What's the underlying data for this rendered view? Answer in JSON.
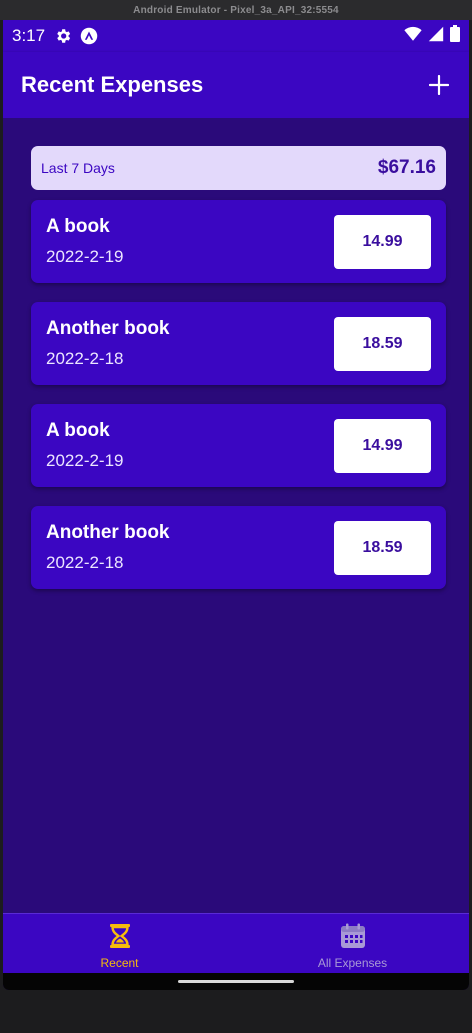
{
  "emulator": {
    "title": "Android Emulator - Pixel_3a_API_32:5554"
  },
  "status_bar": {
    "time": "3:17",
    "icons": [
      "gear-icon",
      "app-logo-icon",
      "wifi-icon",
      "signal-icon",
      "battery-icon"
    ]
  },
  "app_bar": {
    "title": "Recent Expenses",
    "add_icon": "plus-icon"
  },
  "summary": {
    "period": "Last 7 Days",
    "sum": "$67.16"
  },
  "expenses": [
    {
      "description": "A book",
      "date": "2022-2-19",
      "amount": "14.99"
    },
    {
      "description": "Another book",
      "date": "2022-2-18",
      "amount": "18.59"
    },
    {
      "description": "A book",
      "date": "2022-2-19",
      "amount": "14.99"
    },
    {
      "description": "Another book",
      "date": "2022-2-18",
      "amount": "18.59"
    }
  ],
  "tabs": [
    {
      "label": "Recent",
      "icon": "hourglass-icon",
      "active": true
    },
    {
      "label": "All Expenses",
      "icon": "calendar-icon",
      "active": false
    }
  ],
  "colors": {
    "primary": "#3b06c2",
    "background": "#2a0a7a",
    "summary_bg": "#e3d9fb",
    "accent": "#f7bc0c",
    "inactive_tab": "#a99ad6"
  }
}
